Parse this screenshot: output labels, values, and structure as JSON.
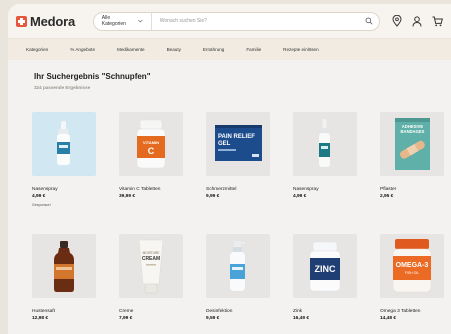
{
  "brand": {
    "name": "Medora"
  },
  "search": {
    "category": "Alle Kategorien",
    "placeholder": "Wonach suchen Sie?"
  },
  "nav": [
    "Kategorien",
    "% Angebote",
    "Medikamente",
    "Beauty",
    "Ernährung",
    "Familie",
    "Rezepte einlösen"
  ],
  "results": {
    "title": "Ihr Suchergebnis \"Schnupfen\"",
    "count": "324 passende Ergebnisse"
  },
  "products": [
    {
      "name": "Nasenspray",
      "price": "4,99 €",
      "note": "Gesponsort",
      "image": "nasal-spray-image",
      "highlight": true
    },
    {
      "name": "Vitamin C Tabletten",
      "price": "39,99 €",
      "image": "vitamin-c-bottle-image",
      "label": [
        "VITAMIN",
        "C"
      ]
    },
    {
      "name": "Schmerzmittel",
      "price": "9,99 €",
      "image": "pain-relief-box-image",
      "label": [
        "PAIN RELIEF",
        "GEL"
      ]
    },
    {
      "name": "Nasenspray",
      "price": "4,99 €",
      "image": "nasal-spray-image"
    },
    {
      "name": "Pflaster",
      "price": "2,95 €",
      "image": "bandage-box-image",
      "label": [
        "ADHESIVE",
        "BANDAGES"
      ]
    },
    {
      "name": "Hustensaft",
      "price": "12,98 €",
      "image": "cough-syrup-image"
    },
    {
      "name": "Creme",
      "price": "7,99 €",
      "image": "cream-tube-image",
      "label": [
        "MOISTURE",
        "CREAM"
      ]
    },
    {
      "name": "Desinfektion",
      "price": "9,59 €",
      "image": "disinfectant-spray-image"
    },
    {
      "name": "Zink",
      "price": "16,49 €",
      "image": "zinc-bottle-image",
      "label": [
        "ZINC"
      ]
    },
    {
      "name": "Omega 3 Tabletten",
      "price": "14,48 €",
      "image": "omega-bottle-image",
      "label": [
        "OMEGA-3",
        "FISH OIL"
      ]
    }
  ],
  "icons": {
    "location": "location-pin-icon",
    "account": "user-icon",
    "cart": "cart-icon",
    "search": "search-icon"
  },
  "colors": {
    "accent": "#e4573d",
    "highlight_bg": "#d1e7f1",
    "header_bg": "#f7f4ef"
  }
}
